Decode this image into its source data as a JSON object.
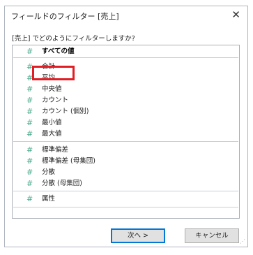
{
  "dialog": {
    "title": "フィールドのフィルター [売上]",
    "close_glyph": "✕",
    "prompt": "[売上] でどのようにフィルターしますか?"
  },
  "list": {
    "hash_glyph": "#",
    "items": [
      {
        "label": "すべての値",
        "group": 0
      },
      {
        "label": "合計",
        "group": 1,
        "selected": true
      },
      {
        "label": "平均",
        "group": 1
      },
      {
        "label": "中央値",
        "group": 1
      },
      {
        "label": "カウント",
        "group": 1
      },
      {
        "label": "カウント (個別)",
        "group": 1
      },
      {
        "label": "最小値",
        "group": 1
      },
      {
        "label": "最大値",
        "group": 1
      },
      {
        "label": "標準偏差",
        "group": 2
      },
      {
        "label": "標準偏差 (母集団)",
        "group": 2
      },
      {
        "label": "分散",
        "group": 2
      },
      {
        "label": "分散 (母集団)",
        "group": 2
      },
      {
        "label": "属性",
        "group": 3
      }
    ]
  },
  "buttons": {
    "next_label": "次へ >",
    "cancel_label": "キャンセル"
  },
  "colors": {
    "hash_icon": "#48a98c",
    "highlight": "#e21e25",
    "default_button_border": "#0078d7"
  }
}
